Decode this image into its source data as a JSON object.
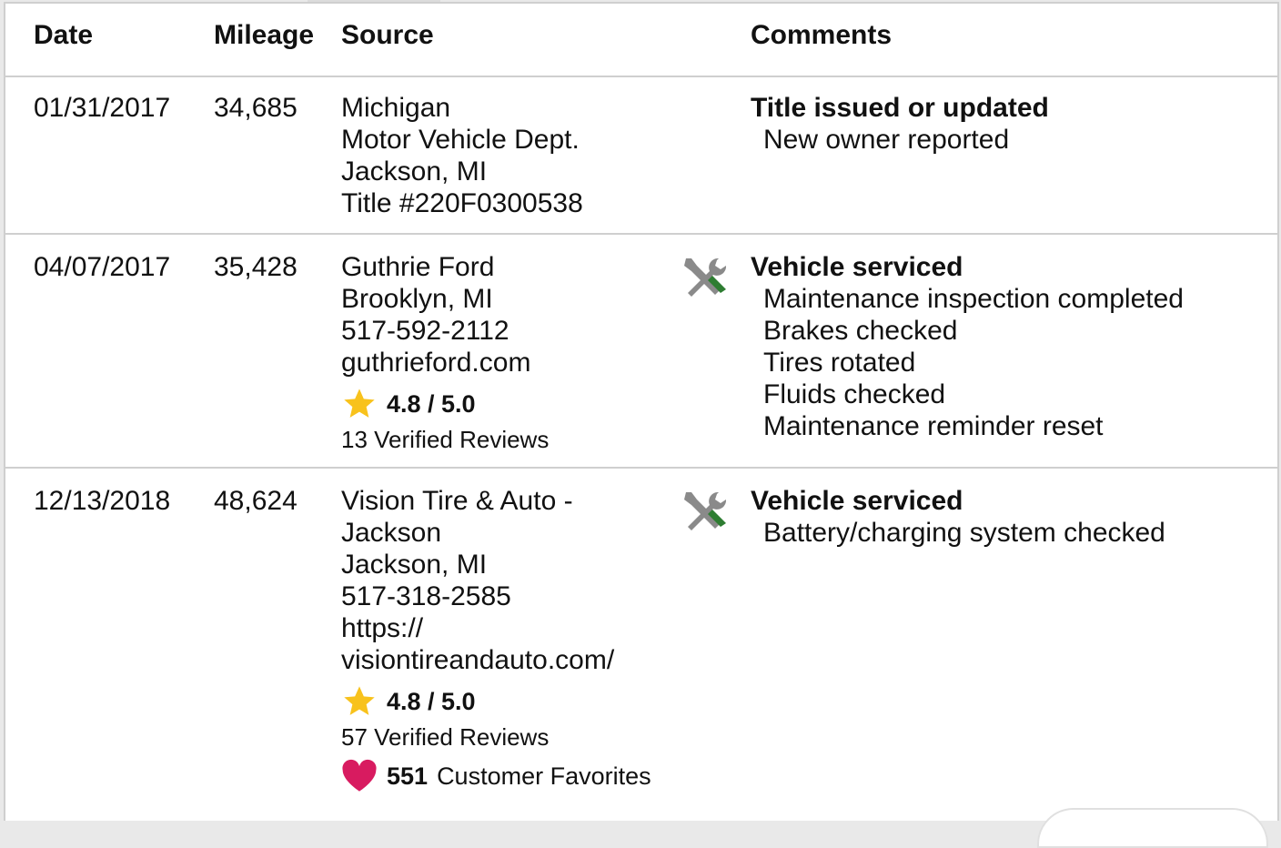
{
  "headers": {
    "date": "Date",
    "mileage": "Mileage",
    "source": "Source",
    "comments": "Comments"
  },
  "rows": [
    {
      "date": "01/31/2017",
      "mileage": "34,685",
      "source_lines": [
        "Michigan",
        "Motor Vehicle Dept.",
        "Jackson, MI",
        "Title #220F0300538"
      ],
      "icon": null,
      "comment_title": "Title issued or updated",
      "comment_items": [
        "New owner reported"
      ]
    },
    {
      "date": "04/07/2017",
      "mileage": "35,428",
      "source_lines": [
        "Guthrie Ford",
        "Brooklyn, MI",
        "517-592-2112",
        "guthrieford.com"
      ],
      "rating": "4.8 / 5.0",
      "reviews": "13 Verified Reviews",
      "icon": "service-tools-icon",
      "comment_title": "Vehicle serviced",
      "comment_items": [
        "Maintenance inspection completed",
        "Brakes checked",
        "Tires rotated",
        "Fluids checked",
        "Maintenance reminder reset"
      ]
    },
    {
      "date": "12/13/2018",
      "mileage": "48,624",
      "source_lines": [
        "Vision Tire & Auto -",
        "Jackson",
        "Jackson, MI",
        "517-318-2585",
        "https://",
        "visiontireandauto.com/"
      ],
      "rating": "4.8 / 5.0",
      "reviews": "57 Verified Reviews",
      "favorites_count": "551",
      "favorites_label": "Customer Favorites",
      "icon": "service-tools-icon",
      "comment_title": "Vehicle serviced",
      "comment_items": [
        "Battery/charging system checked"
      ]
    }
  ],
  "colors": {
    "star": "#f8c21c",
    "heart": "#d81b60",
    "wrench": "#8a8a8a",
    "screwdriver": "#2e7d32",
    "divider": "#cfcfcf"
  }
}
